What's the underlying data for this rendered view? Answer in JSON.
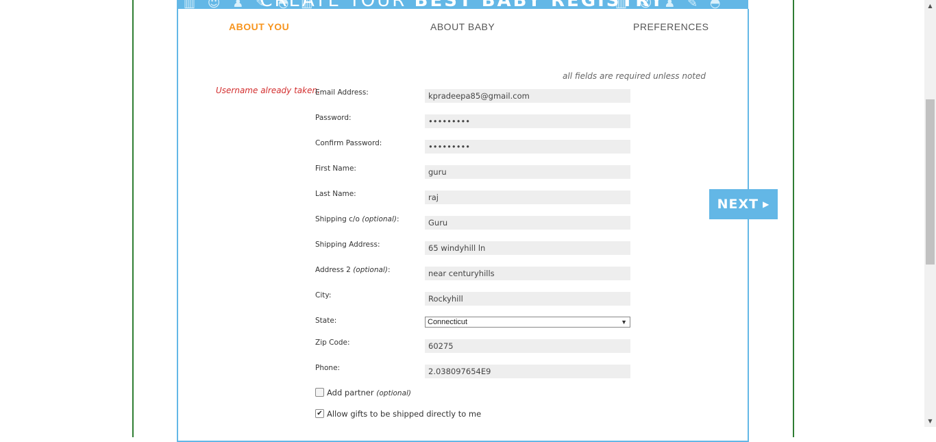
{
  "banner": {
    "title_light": "CREATE YOUR",
    "title_bold": "BEST BABY REGISTRY"
  },
  "tabs": [
    {
      "label": "ABOUT YOU",
      "active": true
    },
    {
      "label": "ABOUT BABY",
      "active": false
    },
    {
      "label": "PREFERENCES",
      "active": false
    }
  ],
  "form": {
    "required_note": "all fields are required unless noted",
    "error": "Username already taken.",
    "optional_text": "(optional)",
    "fields": {
      "email": {
        "label": "Email Address:",
        "value": "kpradeepa85@gmail.com"
      },
      "password": {
        "label": "Password:",
        "value": "•••••••••"
      },
      "confirm_password": {
        "label": "Confirm Password:",
        "value": "•••••••••"
      },
      "first_name": {
        "label": "First Name:",
        "value": "guru"
      },
      "last_name": {
        "label": "Last Name:",
        "value": "raj"
      },
      "shipping_co": {
        "label": "Shipping c/o",
        "value": "Guru"
      },
      "shipping_address": {
        "label": "Shipping Address:",
        "value": "65 windyhill ln"
      },
      "address2": {
        "label": "Address 2",
        "value": "near centuryhills"
      },
      "city": {
        "label": "City:",
        "value": "Rockyhill"
      },
      "state": {
        "label": "State:",
        "value": "Connecticut"
      },
      "zip": {
        "label": "Zip Code:",
        "value": "60275"
      },
      "phone": {
        "label": "Phone:",
        "value": "2.038097654E9"
      }
    },
    "add_partner": {
      "label": "Add partner",
      "checked": false
    },
    "allow_gifts": {
      "label": "Allow gifts to be shipped directly to me",
      "checked": true
    }
  },
  "next_button": {
    "label": "NEXT"
  },
  "colors": {
    "accent_blue": "#63b7e6",
    "active_tab": "#f7941d",
    "error": "#d32f2f",
    "frame_green": "#2e7d32"
  },
  "icons": {
    "next_chevron": "chevron-right-icon",
    "select_arrow": "caret-down-icon",
    "checkbox_check": "check-icon"
  }
}
